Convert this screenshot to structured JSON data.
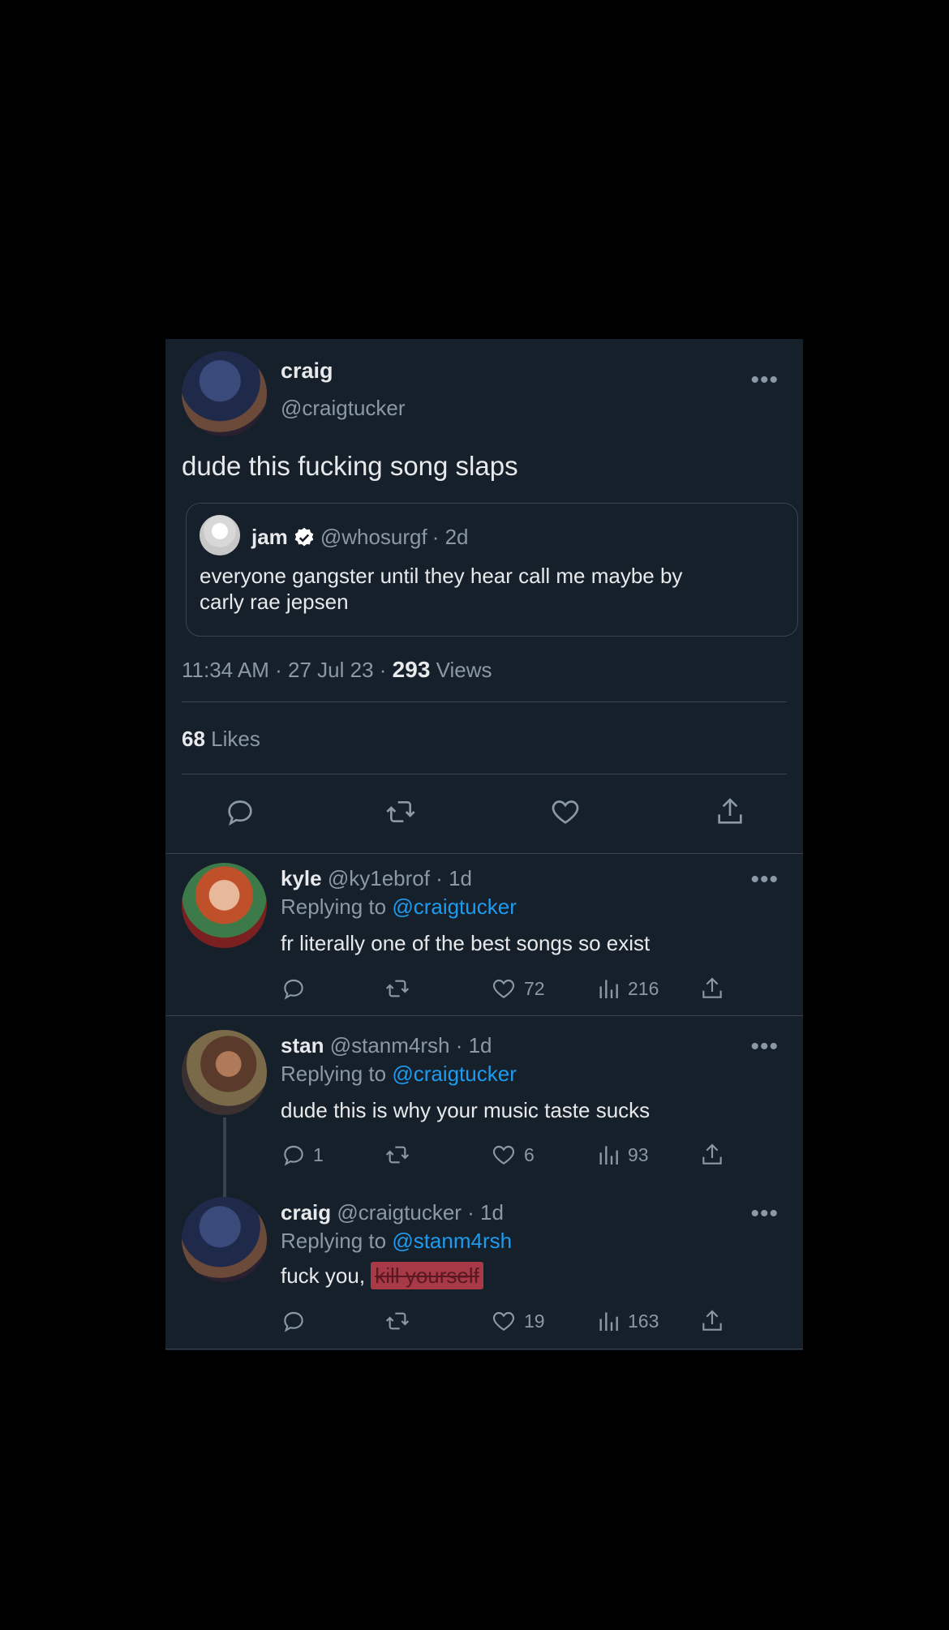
{
  "main_tweet": {
    "name": "craig",
    "handle": "@craigtucker",
    "text": "dude this fucking song slaps",
    "quote": {
      "name": "jam",
      "handle": "@whosurgf",
      "time": "· 2d",
      "text_line1": "everyone gangster until they hear call me maybe by",
      "text_line2": "carly rae jepsen"
    },
    "timestamp": "11:34 AM · 27 Jul 23 · ",
    "views_count": "293",
    "views_label": "Views",
    "likes_count": "68",
    "likes_label": "Likes",
    "more": "•••"
  },
  "replies": [
    {
      "name": "kyle",
      "meta": "@ky1ebrof · 1d",
      "replying_prefix": "Replying to",
      "replying_to": "@craigtucker",
      "text": "fr literally one of the best songs so exist",
      "reply_count": "",
      "like_count": "72",
      "view_count": "216"
    },
    {
      "name": "stan",
      "meta": "@stanm4rsh · 1d",
      "replying_prefix": "Replying to",
      "replying_to": "@craigtucker",
      "text": "dude this is why your music taste sucks",
      "reply_count": "1",
      "like_count": "6",
      "view_count": "93"
    },
    {
      "name": "craig",
      "meta": "@craigtucker · 1d",
      "replying_prefix": "Replying to",
      "replying_to": "@stanm4rsh",
      "text": "fuck you, ",
      "text_redacted": "kill yourself",
      "reply_count": "",
      "like_count": "19",
      "view_count": "163"
    }
  ],
  "colors": {
    "background": "#15202b",
    "link": "#1d9bf0",
    "muted": "#8b98a5",
    "redaction": "#a83a48"
  }
}
